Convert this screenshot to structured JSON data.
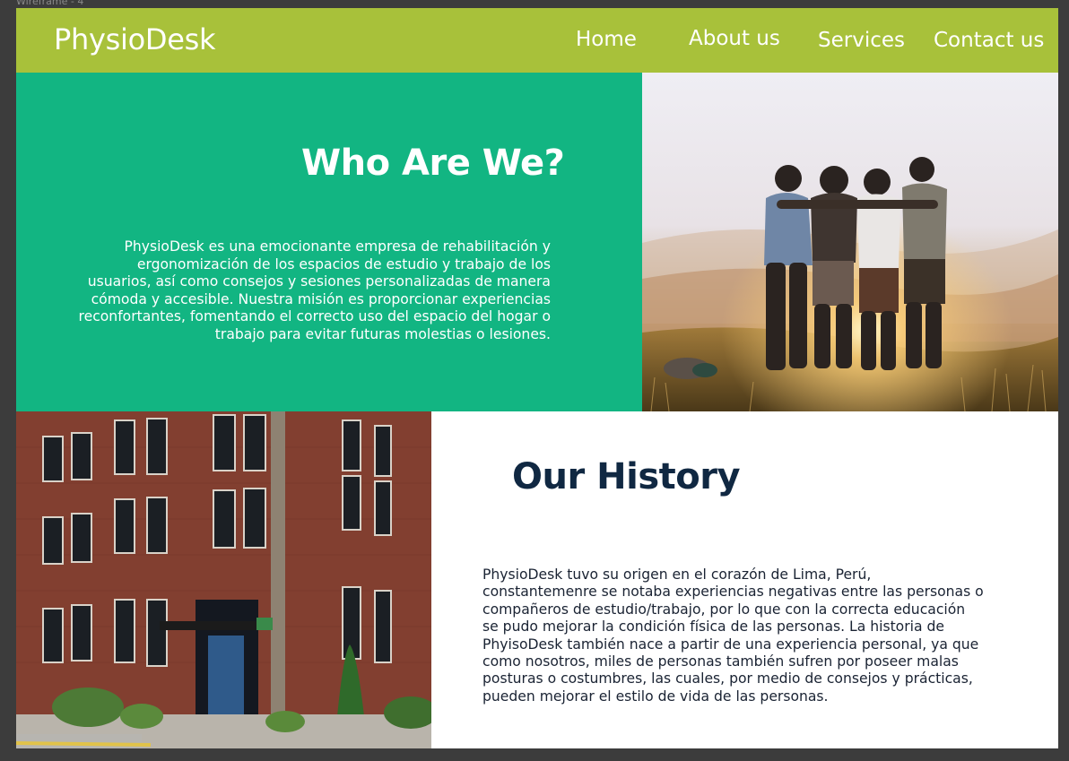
{
  "canvas": {
    "frame_label": "Wireframe - 4"
  },
  "navbar": {
    "brand": "PhysioDesk",
    "items": [
      {
        "label": "Home"
      },
      {
        "label": "About us"
      },
      {
        "label": "Services"
      },
      {
        "label": "Contact us"
      }
    ],
    "background_color": "#a8c13a"
  },
  "who": {
    "title": "Who Are We?",
    "text": "PhysioDesk es una emocionante empresa  de rehabilitación y ergonomización de los espacios de estudio y trabajo de los usuarios, así como consejos y sesiones personalizadas de manera cómoda y accesible. Nuestra misión es proporcionar experiencias reconfortantes, fomentando el  correcto uso del espacio del hogar o trabajo para evitar futuras molestias o lesiones.",
    "background_color": "#12b582",
    "image": "group-of-friends-at-sunset-photo"
  },
  "history": {
    "title": "Our History",
    "text": "PhysioDesk tuvo su origen en el corazón de Lima, Perú, constantemenre se notaba experiencias negativas entre las personas o compañeros de estudio/trabajo, por lo que con la correcta educación se pudo mejorar la condición física de las personas. La historia de PhyisoDesk también nace a partir de una experiencia personal, ya que como nosotros, miles de personas también sufren por poseer malas posturas o costumbres, las cuales, por medio de consejos y prácticas, pueden mejorar el estilo de vida de las personas.",
    "title_color": "#102842",
    "image": "brick-office-building-photo"
  }
}
